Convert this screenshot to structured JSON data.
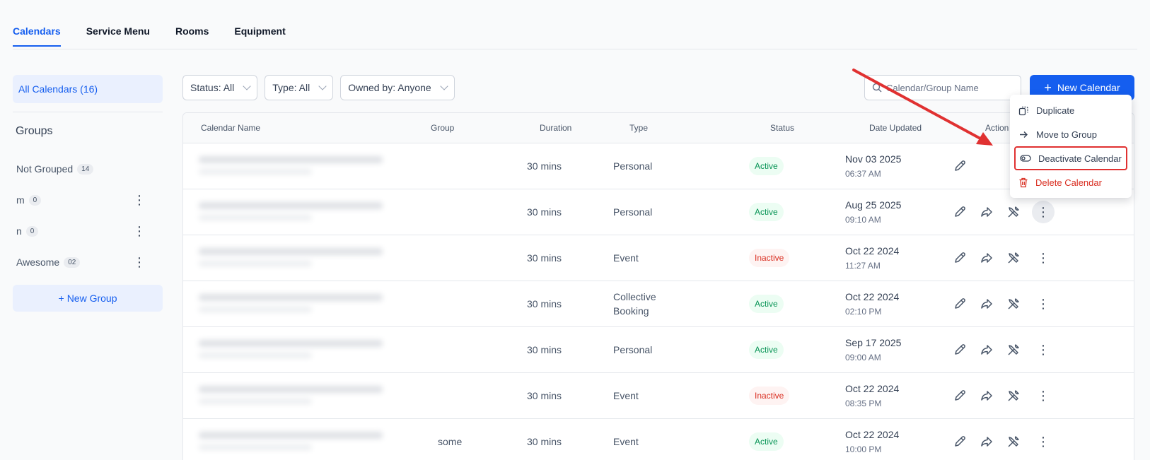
{
  "tabs": [
    {
      "label": "Calendars",
      "active": true
    },
    {
      "label": "Service Menu",
      "active": false
    },
    {
      "label": "Rooms",
      "active": false
    },
    {
      "label": "Equipment",
      "active": false
    }
  ],
  "sidebar": {
    "all_calendars": "All Calendars (16)",
    "groups_title": "Groups",
    "groups": [
      {
        "name": "Not Grouped",
        "count": "14"
      },
      {
        "name": "m",
        "count": "0"
      },
      {
        "name": "n",
        "count": "0"
      },
      {
        "name": "Awesome",
        "count": "02"
      }
    ],
    "new_group": "New Group"
  },
  "filters": [
    "Status: All",
    "Type: All",
    "Owned by: Anyone"
  ],
  "search": {
    "placeholder": "Calendar/Group Name"
  },
  "new_calendar": "New Calendar",
  "table": {
    "headers": [
      "Calendar Name",
      "Group",
      "Duration",
      "Type",
      "Status",
      "Date Updated",
      "Action"
    ],
    "rows": [
      {
        "group": "",
        "duration": "30 mins",
        "type": [
          "Personal"
        ],
        "status": "Active",
        "date": "Nov 03 2025",
        "time": "06:37 AM"
      },
      {
        "group": "",
        "duration": "30 mins",
        "type": [
          "Personal"
        ],
        "status": "Active",
        "date": "Aug 25 2025",
        "time": "09:10 AM"
      },
      {
        "group": "",
        "duration": "30 mins",
        "type": [
          "Event"
        ],
        "status": "Inactive",
        "date": "Oct 22 2024",
        "time": "11:27 AM"
      },
      {
        "group": "",
        "duration": "30 mins",
        "type": [
          "Collective",
          "Booking"
        ],
        "status": "Active",
        "date": "Oct 22 2024",
        "time": "02:10 PM"
      },
      {
        "group": "",
        "duration": "30 mins",
        "type": [
          "Personal"
        ],
        "status": "Active",
        "date": "Sep 17 2025",
        "time": "09:00 AM"
      },
      {
        "group": "",
        "duration": "30 mins",
        "type": [
          "Event"
        ],
        "status": "Inactive",
        "date": "Oct 22 2024",
        "time": "08:35 PM"
      },
      {
        "group": "some",
        "duration": "30 mins",
        "type": [
          "Event"
        ],
        "status": "Active",
        "date": "Oct 22 2024",
        "time": "10:00 PM"
      }
    ]
  },
  "menu": {
    "items": [
      {
        "label": "Duplicate",
        "icon": "copy-icon"
      },
      {
        "label": "Move to Group",
        "icon": "arrow-right-icon"
      },
      {
        "label": "Deactivate Calendar",
        "icon": "toggle-icon"
      },
      {
        "label": "Delete Calendar",
        "icon": "trash-icon"
      }
    ]
  },
  "colors": {
    "accent": "#155eef",
    "active": "#079455",
    "inactive": "#d92d20",
    "annotation": "#e03131"
  }
}
